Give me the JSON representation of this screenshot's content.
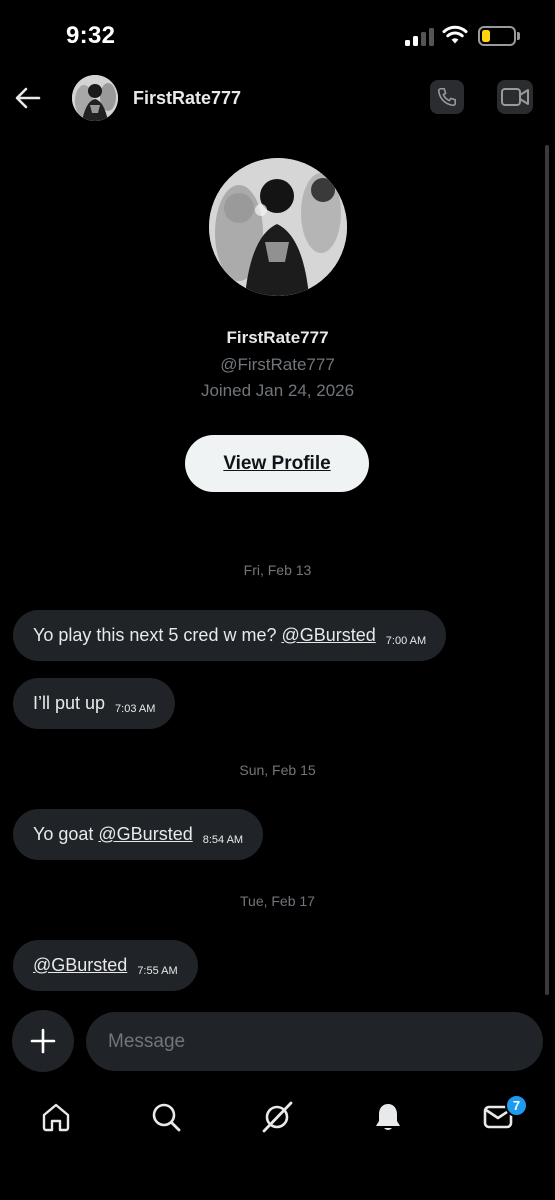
{
  "status_bar": {
    "time": "9:32"
  },
  "header": {
    "title": "FirstRate777"
  },
  "profile": {
    "name": "FirstRate777",
    "handle": "@FirstRate777",
    "joined": "Joined Jan 24, 2026",
    "view_profile_label": "View Profile"
  },
  "conversation": {
    "groups": [
      {
        "date": "Fri, Feb 13",
        "messages": [
          {
            "text": "Yo play this next 5 cred w me? ",
            "mention": "@GBursted",
            "time": "7:00 AM"
          },
          {
            "text": "I’ll put up",
            "mention": "",
            "time": "7:03 AM"
          }
        ]
      },
      {
        "date": "Sun, Feb 15",
        "messages": [
          {
            "text": "Yo goat ",
            "mention": "@GBursted",
            "time": "8:54 AM"
          }
        ]
      },
      {
        "date": "Tue, Feb 17",
        "messages": [
          {
            "text": "",
            "mention": "@GBursted",
            "time": "7:55 AM"
          }
        ]
      }
    ]
  },
  "composer": {
    "placeholder": "Message"
  },
  "bottom_nav": {
    "items": [
      "home-icon",
      "search-icon",
      "grok-icon",
      "notifications-icon",
      "messages-icon"
    ],
    "messages_badge": "7"
  },
  "colors": {
    "background": "#000000",
    "bubble": "#202327",
    "muted": "#71767b",
    "accent": "#1d9bf0",
    "battery": "#ffd60a"
  }
}
